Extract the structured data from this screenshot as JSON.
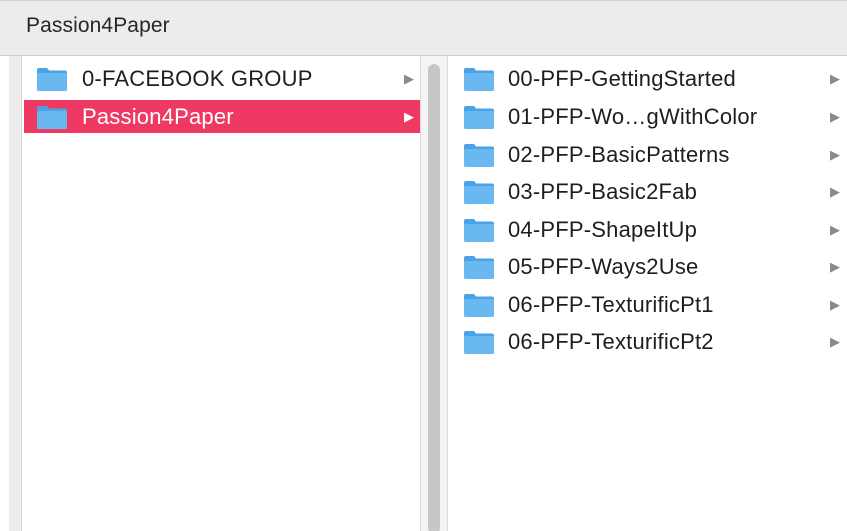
{
  "window": {
    "title": "Passion4Paper"
  },
  "column1": {
    "items": [
      {
        "label": "0-FACEBOOK GROUP",
        "selected": false,
        "icon": "folder-icon"
      },
      {
        "label": "Passion4Paper",
        "selected": true,
        "icon": "folder-icon"
      }
    ]
  },
  "column2": {
    "items": [
      {
        "label": "00-PFP-GettingStarted",
        "icon": "folder-icon"
      },
      {
        "label": "01-PFP-Wo…gWithColor",
        "icon": "folder-icon"
      },
      {
        "label": "02-PFP-BasicPatterns",
        "icon": "folder-icon"
      },
      {
        "label": "03-PFP-Basic2Fab",
        "icon": "folder-icon"
      },
      {
        "label": "04-PFP-ShapeItUp",
        "icon": "folder-icon"
      },
      {
        "label": "05-PFP-Ways2Use",
        "icon": "folder-icon"
      },
      {
        "label": "06-PFP-TexturificPt1",
        "icon": "folder-icon"
      },
      {
        "label": "06-PFP-TexturificPt2",
        "icon": "folder-icon"
      }
    ]
  },
  "colors": {
    "selection": "#ee3963",
    "folder": "#6ab8f0"
  },
  "icons": {
    "disclosure": "chevron-right-icon"
  }
}
